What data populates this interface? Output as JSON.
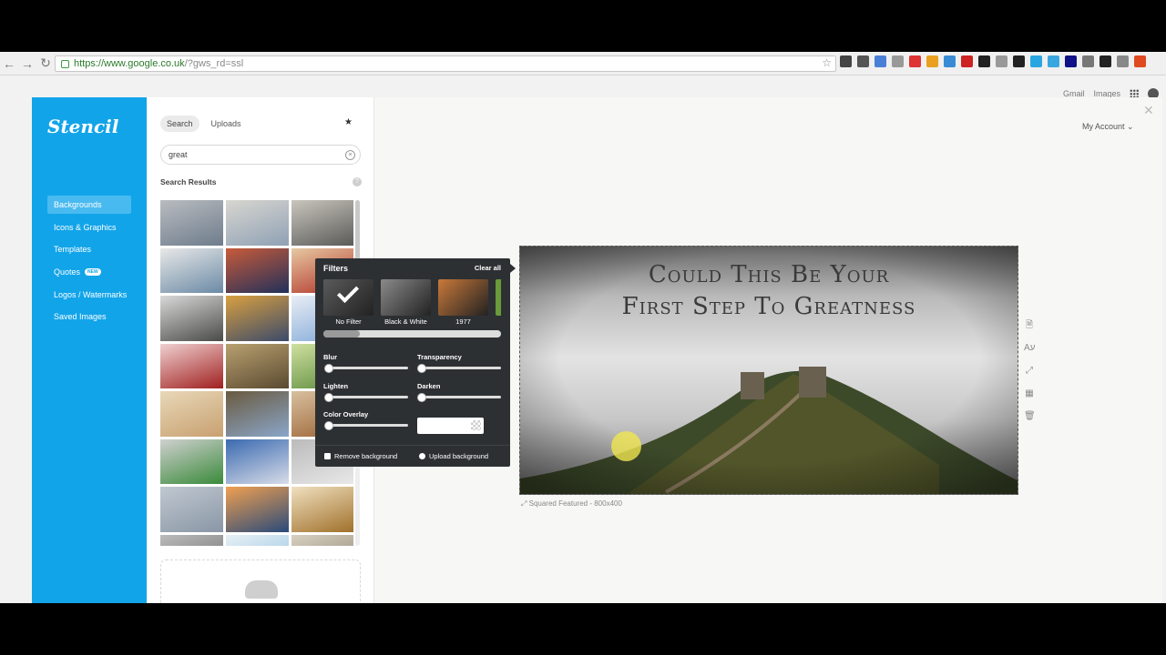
{
  "browser": {
    "url_host": "https://www.google.co.uk",
    "url_path": "/?gws_rd=ssl",
    "extension_colors": [
      "#444",
      "#555",
      "#4a7fd6",
      "#999",
      "#d33",
      "#e9a020",
      "#3a8bd6",
      "#c22",
      "#222",
      "#999",
      "#222",
      "#2aa6e0",
      "#3aa6e0",
      "#118",
      "#777",
      "#222",
      "#888",
      "#e04a20"
    ]
  },
  "google": {
    "gmail": "Gmail",
    "images": "Images"
  },
  "app": {
    "logo": "Stencil",
    "account": "My Account",
    "sidebar": {
      "items": [
        {
          "label": "Backgrounds",
          "active": true
        },
        {
          "label": "Icons & Graphics"
        },
        {
          "label": "Templates"
        },
        {
          "label": "Quotes",
          "badge": "NEW"
        },
        {
          "label": "Logos / Watermarks"
        },
        {
          "label": "Saved Images"
        }
      ]
    },
    "panel": {
      "tab_search": "Search",
      "tab_uploads": "Uploads",
      "search_value": "great",
      "results_label": "Search Results",
      "help": "?",
      "thumb_colors": [
        [
          "#6e7c8c",
          "#b9bcc0"
        ],
        [
          "#8fa1b5",
          "#d8d6d0"
        ],
        [
          "#5a5a58",
          "#c9c6bd"
        ],
        [
          "#6b8aa5",
          "#e8e8e8"
        ],
        [
          "#22305a",
          "#c85b3a"
        ],
        [
          "#b03025",
          "#e7c9a3"
        ],
        [
          "#4a4a48",
          "#d9d9d9"
        ],
        [
          "#3b4a6a",
          "#d9a040"
        ],
        [
          "#7fa6d6",
          "#e8eef5"
        ],
        [
          "#a02020",
          "#f0d0d0"
        ],
        [
          "#5a4a30",
          "#b8a070"
        ],
        [
          "#5a8a3a",
          "#cfe0a0"
        ],
        [
          "#c8a070",
          "#e8d8b8"
        ],
        [
          "#8aa6c9",
          "#6a5a40"
        ],
        [
          "#9a6030",
          "#d8c0a0"
        ],
        [
          "#3a8a3a",
          "#d0d0d0"
        ],
        [
          "#d8dce8",
          "#3a6ab0"
        ],
        [
          "#e8e8e8",
          "#bbbbbb"
        ],
        [
          "#8a96a6",
          "#c0c8d0"
        ],
        [
          "#2a4a7a",
          "#f0a050"
        ],
        [
          "#a0702a",
          "#f0e0c0"
        ],
        [
          "#6a6a6a",
          "#bbbbbb"
        ],
        [
          "#8ac0e0",
          "#e8f0f5"
        ],
        [
          "#8a8070",
          "#d8d0c0"
        ]
      ]
    },
    "canvas": {
      "headline_line1": "Could This Be Your",
      "headline_line2": "First Step To Greatness",
      "size_label": "Squared Featured - 800x400"
    },
    "tools": [
      "page-icon",
      "text-icon",
      "resize-icon",
      "grid-icon",
      "trash-icon"
    ],
    "filters": {
      "title": "Filters",
      "clear_all": "Clear all",
      "swatches": [
        {
          "label": "No Filter",
          "color": "#5a5a5a",
          "selected": true
        },
        {
          "label": "Black & White",
          "color": "#8a8a8a"
        },
        {
          "label": "1977",
          "color": "#c9793a"
        }
      ],
      "blur": "Blur",
      "transparency": "Transparency",
      "lighten": "Lighten",
      "darken": "Darken",
      "color_overlay": "Color Overlay",
      "remove_background": "Remove background",
      "upload_background": "Upload background",
      "levels": {
        "blur": 0,
        "transparency": 0,
        "lighten": 0,
        "darken": 0,
        "color_overlay": 0
      }
    }
  }
}
